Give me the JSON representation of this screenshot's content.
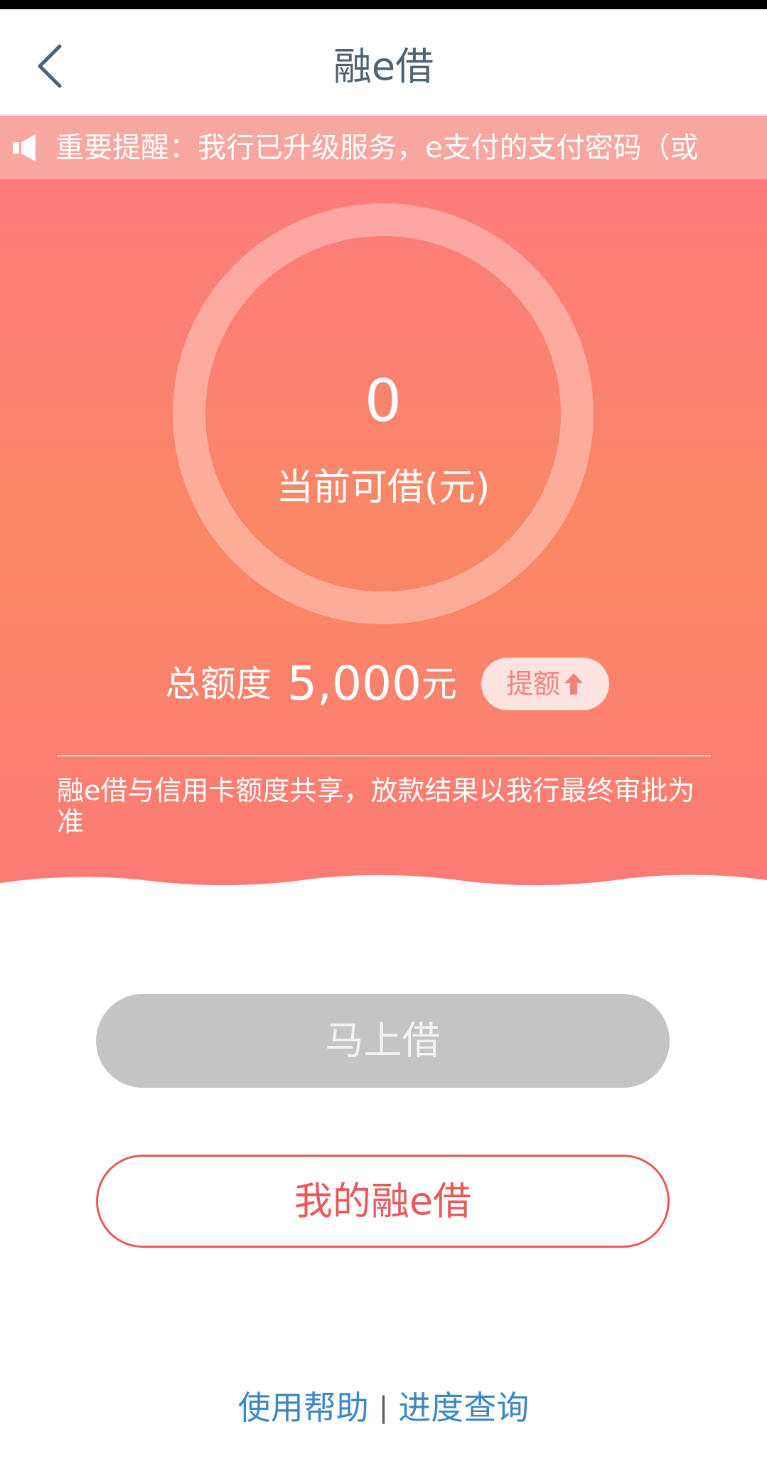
{
  "header": {
    "title": "融e借"
  },
  "notice": {
    "text": "重要提醒：我行已升级服务，e支付的支付密码（或"
  },
  "credit": {
    "available_amount": "0",
    "available_label": "当前可借(元)",
    "total_label": "总额度",
    "total_amount": "5,000",
    "total_unit": "元",
    "raise_label": "提额",
    "share_note": "融e借与信用卡额度共享，放款结果以我行最终审批为准"
  },
  "actions": {
    "borrow_now_label": "马上借",
    "my_loan_label": "我的融e借"
  },
  "footer": {
    "help_label": "使用帮助",
    "separator": "|",
    "progress_label": "进度查询"
  },
  "colors": {
    "hero_top": "#fd7b7c",
    "hero_mid": "#f98865",
    "accent_red": "#e85a5a",
    "link_blue": "#3e87c6",
    "disabled_gray": "#c4c4c4"
  },
  "icons": [
    "back-icon",
    "speaker-icon",
    "arrow-up-icon"
  ]
}
